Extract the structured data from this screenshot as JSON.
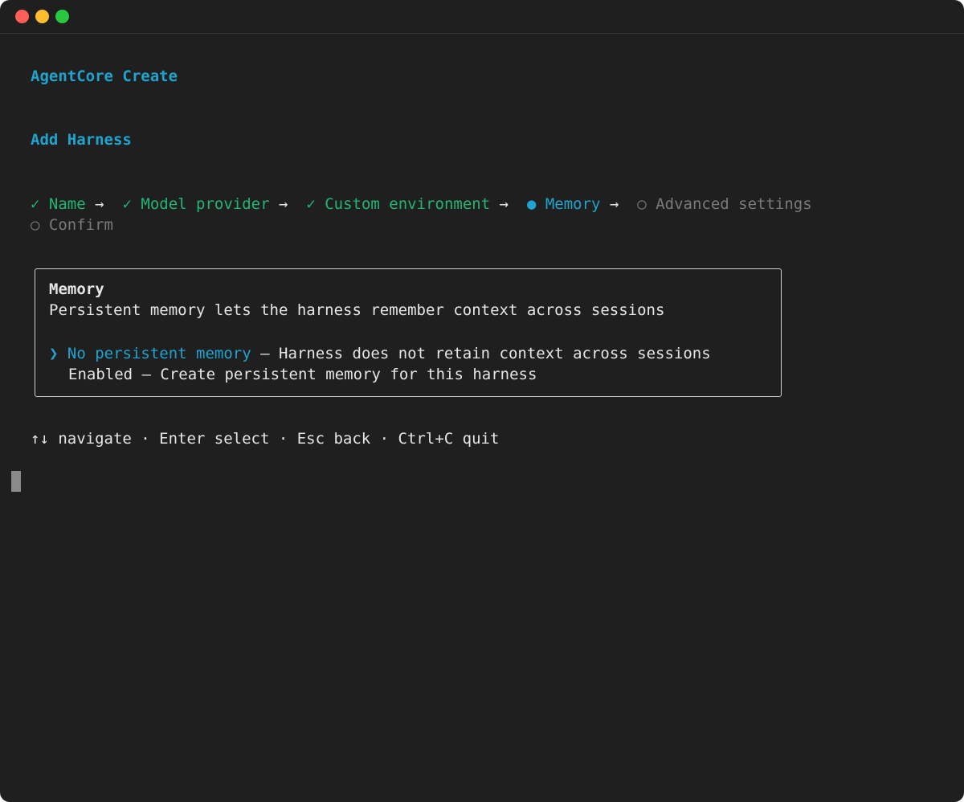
{
  "window": {
    "title_dots": [
      "close",
      "minimize",
      "zoom"
    ]
  },
  "app": {
    "title": "AgentCore Create",
    "section_title": "Add Harness"
  },
  "steps": {
    "completed_mark": "✓",
    "current_mark": "●",
    "pending_mark": "○",
    "arrow": "→",
    "items": [
      {
        "label": "Name",
        "status": "done"
      },
      {
        "label": "Model provider",
        "status": "done"
      },
      {
        "label": "Custom environment",
        "status": "done"
      },
      {
        "label": "Memory",
        "status": "current"
      },
      {
        "label": "Advanced settings",
        "status": "pending"
      },
      {
        "label": "Confirm",
        "status": "pending"
      }
    ]
  },
  "panel": {
    "title": "Memory",
    "description": "Persistent memory lets the harness remember context across sessions",
    "pointer": "❯",
    "options": [
      {
        "label": "No persistent memory",
        "separator": " — ",
        "description": "Harness does not retain context across sessions",
        "selected": true
      },
      {
        "label": "Enabled",
        "separator": " — ",
        "description": "Create persistent memory for this harness",
        "selected": false
      }
    ]
  },
  "help": {
    "text": "↑↓ navigate · Enter select · Esc back · Ctrl+C quit"
  },
  "colors": {
    "background": "#1f1f1f",
    "accent_blue": "#1ea4cf",
    "success_green": "#22b573",
    "dim_gray": "#7a7a7a"
  }
}
